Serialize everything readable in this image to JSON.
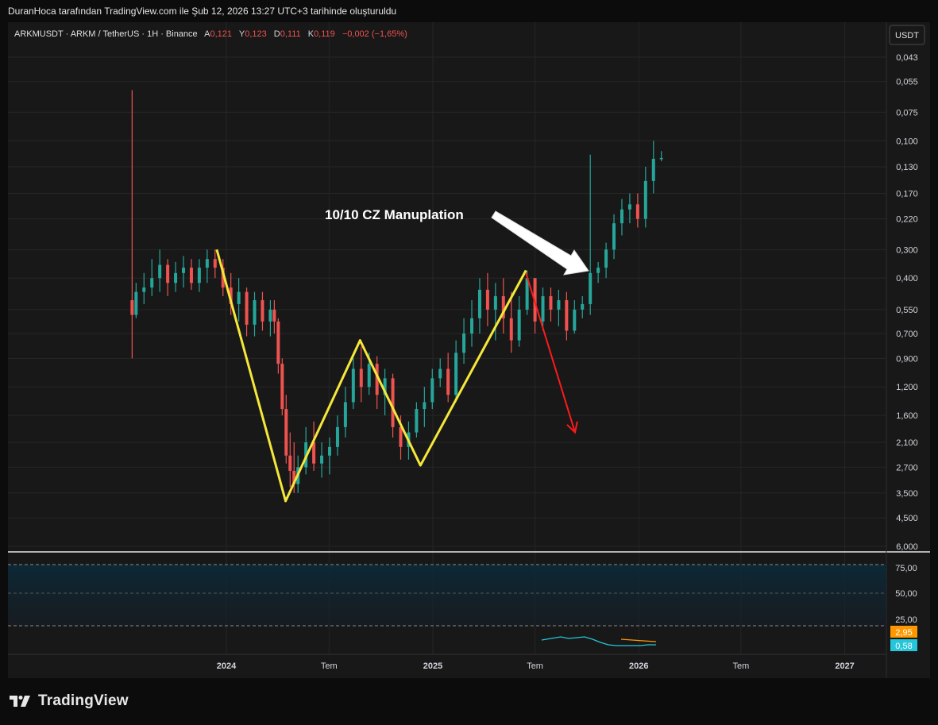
{
  "header": {
    "caption": "DuranHoca tarafından TradingView.com ile Şub 12, 2026 13:27 UTC+3 tarihinde oluşturuldu"
  },
  "legend": {
    "symbol": "ARKMUSDT · ARKM / TetherUS · 1H · Binance",
    "o_label": "A",
    "o_value": "0,121",
    "h_label": "Y",
    "h_value": "0,123",
    "l_label": "D",
    "l_value": "0,111",
    "c_label": "K",
    "c_value": "0,119",
    "change": "−0,002 (−1,65%)"
  },
  "currency_button": "USDT",
  "annotation": {
    "text": "10/10 CZ Manuplation"
  },
  "colors": {
    "up": "#26a69a",
    "down": "#ef5350",
    "pattern": "#f5e73a",
    "arrow_down": "#ff1a1a",
    "annotation": "#ffffff",
    "rsi_line": "#26c6da",
    "rsi_ma": "#ff9800"
  },
  "footer": {
    "brand": "TradingView"
  },
  "chart_data": {
    "type": "candlestick",
    "price_axis": {
      "scale": "log, inverted",
      "tick_labels": [
        "0,043",
        "0,055",
        "0,075",
        "0,100",
        "0,130",
        "0,170",
        "0,220",
        "0,300",
        "0,400",
        "0,550",
        "0,700",
        "0,900",
        "1,200",
        "1,600",
        "2,100",
        "2,700",
        "3,500",
        "4,500",
        "6,000"
      ]
    },
    "time_axis": {
      "tick_labels": [
        "2024",
        "Tem",
        "2025",
        "Tem",
        "2026",
        "Tem",
        "2027"
      ]
    },
    "indicator": {
      "tick_labels": [
        "75,00",
        "50,00",
        "25,00"
      ],
      "badges": [
        {
          "value": "2,95",
          "color": "#ff9800"
        },
        {
          "value": "0,58",
          "color": "#26c6da"
        }
      ]
    },
    "pattern": {
      "name": "M",
      "points": [
        {
          "date": "2023-12-15",
          "price": 0.3
        },
        {
          "date": "2024-04-15",
          "price": 3.8
        },
        {
          "date": "2024-08-25",
          "price": 0.75
        },
        {
          "date": "2024-12-10",
          "price": 2.65
        },
        {
          "date": "2025-06-15",
          "price": 0.37
        }
      ]
    },
    "projection_arrow": {
      "from": {
        "date": "2025-06-15",
        "price": 0.38
      },
      "to": {
        "date": "2025-09-10",
        "price": 1.9
      }
    },
    "candles": [
      {
        "date": "2023-07-18",
        "o": 0.5,
        "h": 0.06,
        "l": 0.9,
        "c": 0.58
      },
      {
        "date": "2023-07-25",
        "o": 0.58,
        "h": 0.42,
        "l": 0.6,
        "c": 0.46
      },
      {
        "date": "2023-08-08",
        "o": 0.46,
        "h": 0.38,
        "l": 0.52,
        "c": 0.44
      },
      {
        "date": "2023-08-22",
        "o": 0.44,
        "h": 0.33,
        "l": 0.48,
        "c": 0.4
      },
      {
        "date": "2023-09-05",
        "o": 0.4,
        "h": 0.3,
        "l": 0.46,
        "c": 0.35
      },
      {
        "date": "2023-09-19",
        "o": 0.35,
        "h": 0.33,
        "l": 0.48,
        "c": 0.42
      },
      {
        "date": "2023-10-03",
        "o": 0.42,
        "h": 0.34,
        "l": 0.46,
        "c": 0.38
      },
      {
        "date": "2023-10-17",
        "o": 0.38,
        "h": 0.32,
        "l": 0.44,
        "c": 0.36
      },
      {
        "date": "2023-10-31",
        "o": 0.36,
        "h": 0.33,
        "l": 0.45,
        "c": 0.42
      },
      {
        "date": "2023-11-14",
        "o": 0.42,
        "h": 0.33,
        "l": 0.46,
        "c": 0.36
      },
      {
        "date": "2023-11-28",
        "o": 0.36,
        "h": 0.3,
        "l": 0.42,
        "c": 0.33
      },
      {
        "date": "2023-12-12",
        "o": 0.33,
        "h": 0.3,
        "l": 0.4,
        "c": 0.36
      },
      {
        "date": "2023-12-26",
        "o": 0.36,
        "h": 0.33,
        "l": 0.48,
        "c": 0.44
      },
      {
        "date": "2024-01-09",
        "o": 0.44,
        "h": 0.38,
        "l": 0.58,
        "c": 0.52
      },
      {
        "date": "2024-01-23",
        "o": 0.52,
        "h": 0.4,
        "l": 0.62,
        "c": 0.46
      },
      {
        "date": "2024-02-06",
        "o": 0.46,
        "h": 0.44,
        "l": 0.72,
        "c": 0.64
      },
      {
        "date": "2024-02-20",
        "o": 0.64,
        "h": 0.46,
        "l": 0.72,
        "c": 0.5
      },
      {
        "date": "2024-03-05",
        "o": 0.5,
        "h": 0.46,
        "l": 0.68,
        "c": 0.62
      },
      {
        "date": "2024-03-19",
        "o": 0.62,
        "h": 0.5,
        "l": 0.72,
        "c": 0.55
      },
      {
        "date": "2024-03-26",
        "o": 0.55,
        "h": 0.5,
        "l": 0.7,
        "c": 0.62
      },
      {
        "date": "2024-04-02",
        "o": 0.62,
        "h": 0.6,
        "l": 1.05,
        "c": 0.95
      },
      {
        "date": "2024-04-09",
        "o": 0.95,
        "h": 0.9,
        "l": 1.6,
        "c": 1.5
      },
      {
        "date": "2024-04-16",
        "o": 1.5,
        "h": 1.3,
        "l": 2.6,
        "c": 2.4
      },
      {
        "date": "2024-04-23",
        "o": 2.4,
        "h": 1.9,
        "l": 3.3,
        "c": 2.8
      },
      {
        "date": "2024-04-30",
        "o": 2.8,
        "h": 2.1,
        "l": 3.5,
        "c": 3.2
      },
      {
        "date": "2024-05-07",
        "o": 3.2,
        "h": 2.4,
        "l": 3.5,
        "c": 2.7
      },
      {
        "date": "2024-05-21",
        "o": 2.7,
        "h": 1.8,
        "l": 2.9,
        "c": 2.1
      },
      {
        "date": "2024-06-04",
        "o": 2.1,
        "h": 1.7,
        "l": 2.8,
        "c": 2.6
      },
      {
        "date": "2024-06-18",
        "o": 2.6,
        "h": 2.1,
        "l": 3.0,
        "c": 2.4
      },
      {
        "date": "2024-07-02",
        "o": 2.4,
        "h": 2.0,
        "l": 2.9,
        "c": 2.2
      },
      {
        "date": "2024-07-16",
        "o": 2.2,
        "h": 1.6,
        "l": 2.4,
        "c": 1.8
      },
      {
        "date": "2024-07-30",
        "o": 1.8,
        "h": 1.2,
        "l": 2.0,
        "c": 1.4
      },
      {
        "date": "2024-08-13",
        "o": 1.4,
        "h": 0.9,
        "l": 1.5,
        "c": 1.0
      },
      {
        "date": "2024-08-27",
        "o": 1.0,
        "h": 0.8,
        "l": 1.4,
        "c": 1.2
      },
      {
        "date": "2024-09-10",
        "o": 1.2,
        "h": 0.85,
        "l": 1.3,
        "c": 0.95
      },
      {
        "date": "2024-09-24",
        "o": 0.95,
        "h": 0.88,
        "l": 1.5,
        "c": 1.3
      },
      {
        "date": "2024-10-08",
        "o": 1.3,
        "h": 1.0,
        "l": 1.6,
        "c": 1.1
      },
      {
        "date": "2024-10-22",
        "o": 1.1,
        "h": 1.05,
        "l": 2.0,
        "c": 1.8
      },
      {
        "date": "2024-11-05",
        "o": 1.8,
        "h": 1.6,
        "l": 2.5,
        "c": 2.2
      },
      {
        "date": "2024-11-19",
        "o": 2.2,
        "h": 1.7,
        "l": 2.5,
        "c": 1.9
      },
      {
        "date": "2024-12-03",
        "o": 1.9,
        "h": 1.4,
        "l": 2.0,
        "c": 1.5
      },
      {
        "date": "2024-12-17",
        "o": 1.5,
        "h": 1.2,
        "l": 1.8,
        "c": 1.4
      },
      {
        "date": "2024-12-31",
        "o": 1.4,
        "h": 1.0,
        "l": 1.5,
        "c": 1.1
      },
      {
        "date": "2025-01-14",
        "o": 1.1,
        "h": 0.9,
        "l": 1.2,
        "c": 1.0
      },
      {
        "date": "2025-01-28",
        "o": 1.0,
        "h": 0.85,
        "l": 1.4,
        "c": 1.3
      },
      {
        "date": "2025-02-11",
        "o": 1.3,
        "h": 0.75,
        "l": 1.4,
        "c": 0.85
      },
      {
        "date": "2025-02-25",
        "o": 0.85,
        "h": 0.6,
        "l": 0.95,
        "c": 0.7
      },
      {
        "date": "2025-03-11",
        "o": 0.7,
        "h": 0.5,
        "l": 0.8,
        "c": 0.6
      },
      {
        "date": "2025-03-25",
        "o": 0.6,
        "h": 0.4,
        "l": 0.7,
        "c": 0.45
      },
      {
        "date": "2025-04-08",
        "o": 0.45,
        "h": 0.38,
        "l": 0.65,
        "c": 0.55
      },
      {
        "date": "2025-04-22",
        "o": 0.55,
        "h": 0.42,
        "l": 0.75,
        "c": 0.48
      },
      {
        "date": "2025-05-06",
        "o": 0.48,
        "h": 0.4,
        "l": 0.7,
        "c": 0.6
      },
      {
        "date": "2025-05-20",
        "o": 0.6,
        "h": 0.46,
        "l": 0.85,
        "c": 0.75
      },
      {
        "date": "2025-06-03",
        "o": 0.75,
        "h": 0.48,
        "l": 0.8,
        "c": 0.55
      },
      {
        "date": "2025-06-17",
        "o": 0.55,
        "h": 0.37,
        "l": 0.58,
        "c": 0.4
      },
      {
        "date": "2025-07-01",
        "o": 0.4,
        "h": 0.4,
        "l": 0.7,
        "c": 0.62
      },
      {
        "date": "2025-07-15",
        "o": 0.62,
        "h": 0.44,
        "l": 0.68,
        "c": 0.48
      },
      {
        "date": "2025-07-29",
        "o": 0.48,
        "h": 0.44,
        "l": 0.62,
        "c": 0.55
      },
      {
        "date": "2025-08-12",
        "o": 0.55,
        "h": 0.45,
        "l": 0.65,
        "c": 0.5
      },
      {
        "date": "2025-08-26",
        "o": 0.5,
        "h": 0.46,
        "l": 0.75,
        "c": 0.68
      },
      {
        "date": "2025-09-09",
        "o": 0.68,
        "h": 0.5,
        "l": 0.7,
        "c": 0.55
      },
      {
        "date": "2025-09-23",
        "o": 0.55,
        "h": 0.48,
        "l": 0.6,
        "c": 0.52
      },
      {
        "date": "2025-10-07",
        "o": 0.52,
        "h": 0.115,
        "l": 0.58,
        "c": 0.38
      },
      {
        "date": "2025-10-21",
        "o": 0.38,
        "h": 0.34,
        "l": 0.42,
        "c": 0.36
      },
      {
        "date": "2025-11-04",
        "o": 0.36,
        "h": 0.28,
        "l": 0.4,
        "c": 0.3
      },
      {
        "date": "2025-11-18",
        "o": 0.3,
        "h": 0.21,
        "l": 0.33,
        "c": 0.23
      },
      {
        "date": "2025-12-02",
        "o": 0.23,
        "h": 0.18,
        "l": 0.26,
        "c": 0.2
      },
      {
        "date": "2025-12-16",
        "o": 0.2,
        "h": 0.17,
        "l": 0.23,
        "c": 0.19
      },
      {
        "date": "2025-12-30",
        "o": 0.19,
        "h": 0.17,
        "l": 0.24,
        "c": 0.22
      },
      {
        "date": "2026-01-13",
        "o": 0.22,
        "h": 0.13,
        "l": 0.24,
        "c": 0.15
      },
      {
        "date": "2026-01-27",
        "o": 0.15,
        "h": 0.1,
        "l": 0.17,
        "c": 0.12
      },
      {
        "date": "2026-02-10",
        "o": 0.12,
        "h": 0.111,
        "l": 0.123,
        "c": 0.119
      }
    ]
  }
}
